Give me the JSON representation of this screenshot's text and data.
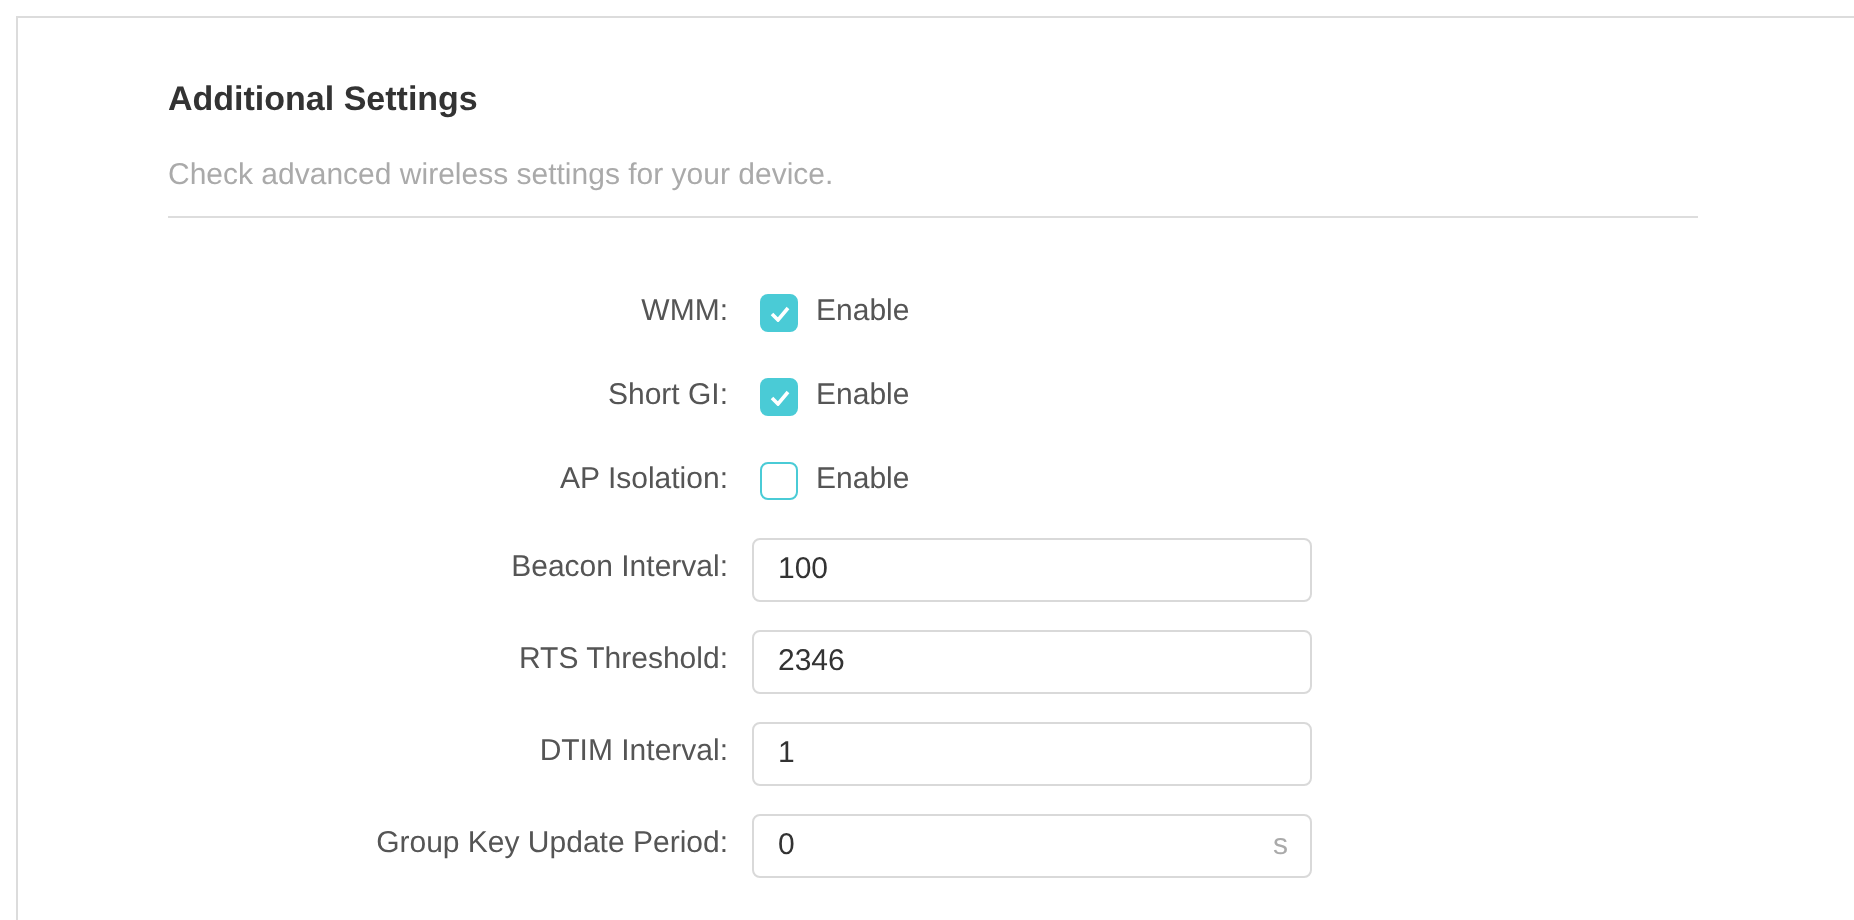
{
  "title": "Additional Settings",
  "subtitle": "Check advanced wireless settings for your device.",
  "fields": [
    {
      "kind": "checkbox",
      "label": "WMM:",
      "option": "Enable",
      "checked": true
    },
    {
      "kind": "checkbox",
      "label": "Short GI:",
      "option": "Enable",
      "checked": true
    },
    {
      "kind": "checkbox",
      "label": "AP Isolation:",
      "option": "Enable",
      "checked": false
    },
    {
      "kind": "text",
      "label": "Beacon Interval:",
      "value": "100"
    },
    {
      "kind": "text",
      "label": "RTS Threshold:",
      "value": "2346"
    },
    {
      "kind": "text",
      "label": "DTIM Interval:",
      "value": "1"
    },
    {
      "kind": "text",
      "label": "Group Key Update Period:",
      "value": "0",
      "unit": "s"
    }
  ]
}
